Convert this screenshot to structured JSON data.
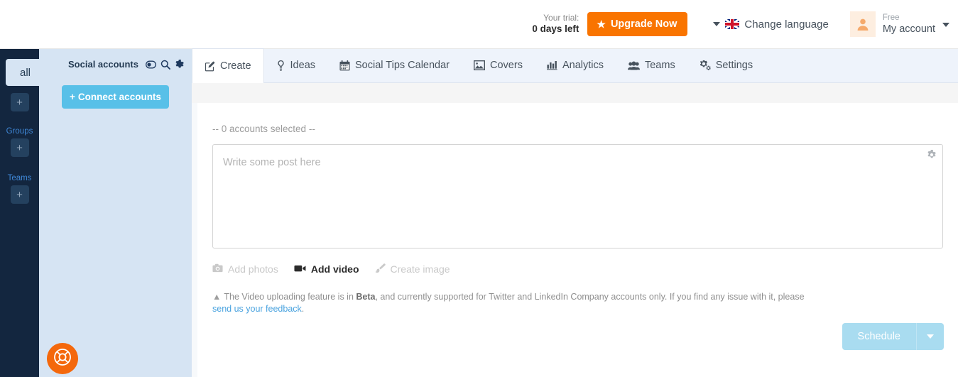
{
  "topbar": {
    "trial_label": "Your trial:",
    "trial_value": "0 days left",
    "upgrade_label": "Upgrade Now",
    "upgrade_icon": "star-icon",
    "language_label": "Change language",
    "language_flag_icon": "uk-flag-icon",
    "language_caret_icon": "caret-down-icon",
    "account_plan": "Free",
    "account_name": "My account",
    "avatar_icon": "user-avatar-icon",
    "account_caret_icon": "caret-down-icon",
    "accent_orange": "#f97400"
  },
  "rail": {
    "all_label": "all",
    "add_account_icon": "plus-icon",
    "add_account_label": "+",
    "groups_label": "Groups",
    "add_group_label": "+",
    "teams_label": "Teams",
    "add_team_label": "+",
    "background": "#13263f"
  },
  "accounts_panel": {
    "title": "Social accounts",
    "toggle_icon": "toggle-switch-icon",
    "search_icon": "search-icon",
    "settings_icon": "gear-icon",
    "connect_label": "Connect accounts",
    "connect_plus": "+",
    "background": "#d6e4f3",
    "connect_color": "#58c0e8"
  },
  "help": {
    "icon": "lifebuoy-icon",
    "color": "#f4680c"
  },
  "tabs": [
    {
      "label": "Create",
      "icon": "pencil-square-icon",
      "active": true
    },
    {
      "label": "Ideas",
      "icon": "lightbulb-icon",
      "active": false
    },
    {
      "label": "Social Tips Calendar",
      "icon": "calendar-icon",
      "active": false
    },
    {
      "label": "Covers",
      "icon": "image-icon",
      "active": false
    },
    {
      "label": "Analytics",
      "icon": "bar-chart-icon",
      "active": false
    },
    {
      "label": "Teams",
      "icon": "users-icon",
      "active": false
    },
    {
      "label": "Settings",
      "icon": "gears-icon",
      "active": false
    }
  ],
  "composer": {
    "accounts_selected": "-- 0 accounts selected --",
    "placeholder": "Write some post here",
    "value": "",
    "settings_icon": "gear-icon"
  },
  "media": [
    {
      "label": "Add photos",
      "icon": "camera-icon",
      "state": "disabled"
    },
    {
      "label": "Add video",
      "icon": "video-camera-icon",
      "state": "enabled"
    },
    {
      "label": "Create image",
      "icon": "paintbrush-icon",
      "state": "disabled"
    }
  ],
  "notice": {
    "icon": "warning-triangle-icon",
    "part1": "The Video uploading feature is in ",
    "bold": "Beta",
    "part2": ", and currently supported for Twitter and LinkedIn Company accounts only. If you find any issue with it, please ",
    "link": "send us your feedback",
    "part3": "."
  },
  "schedule": {
    "label": "Schedule",
    "caret_icon": "caret-down-icon",
    "color": "#a9dcf0"
  }
}
